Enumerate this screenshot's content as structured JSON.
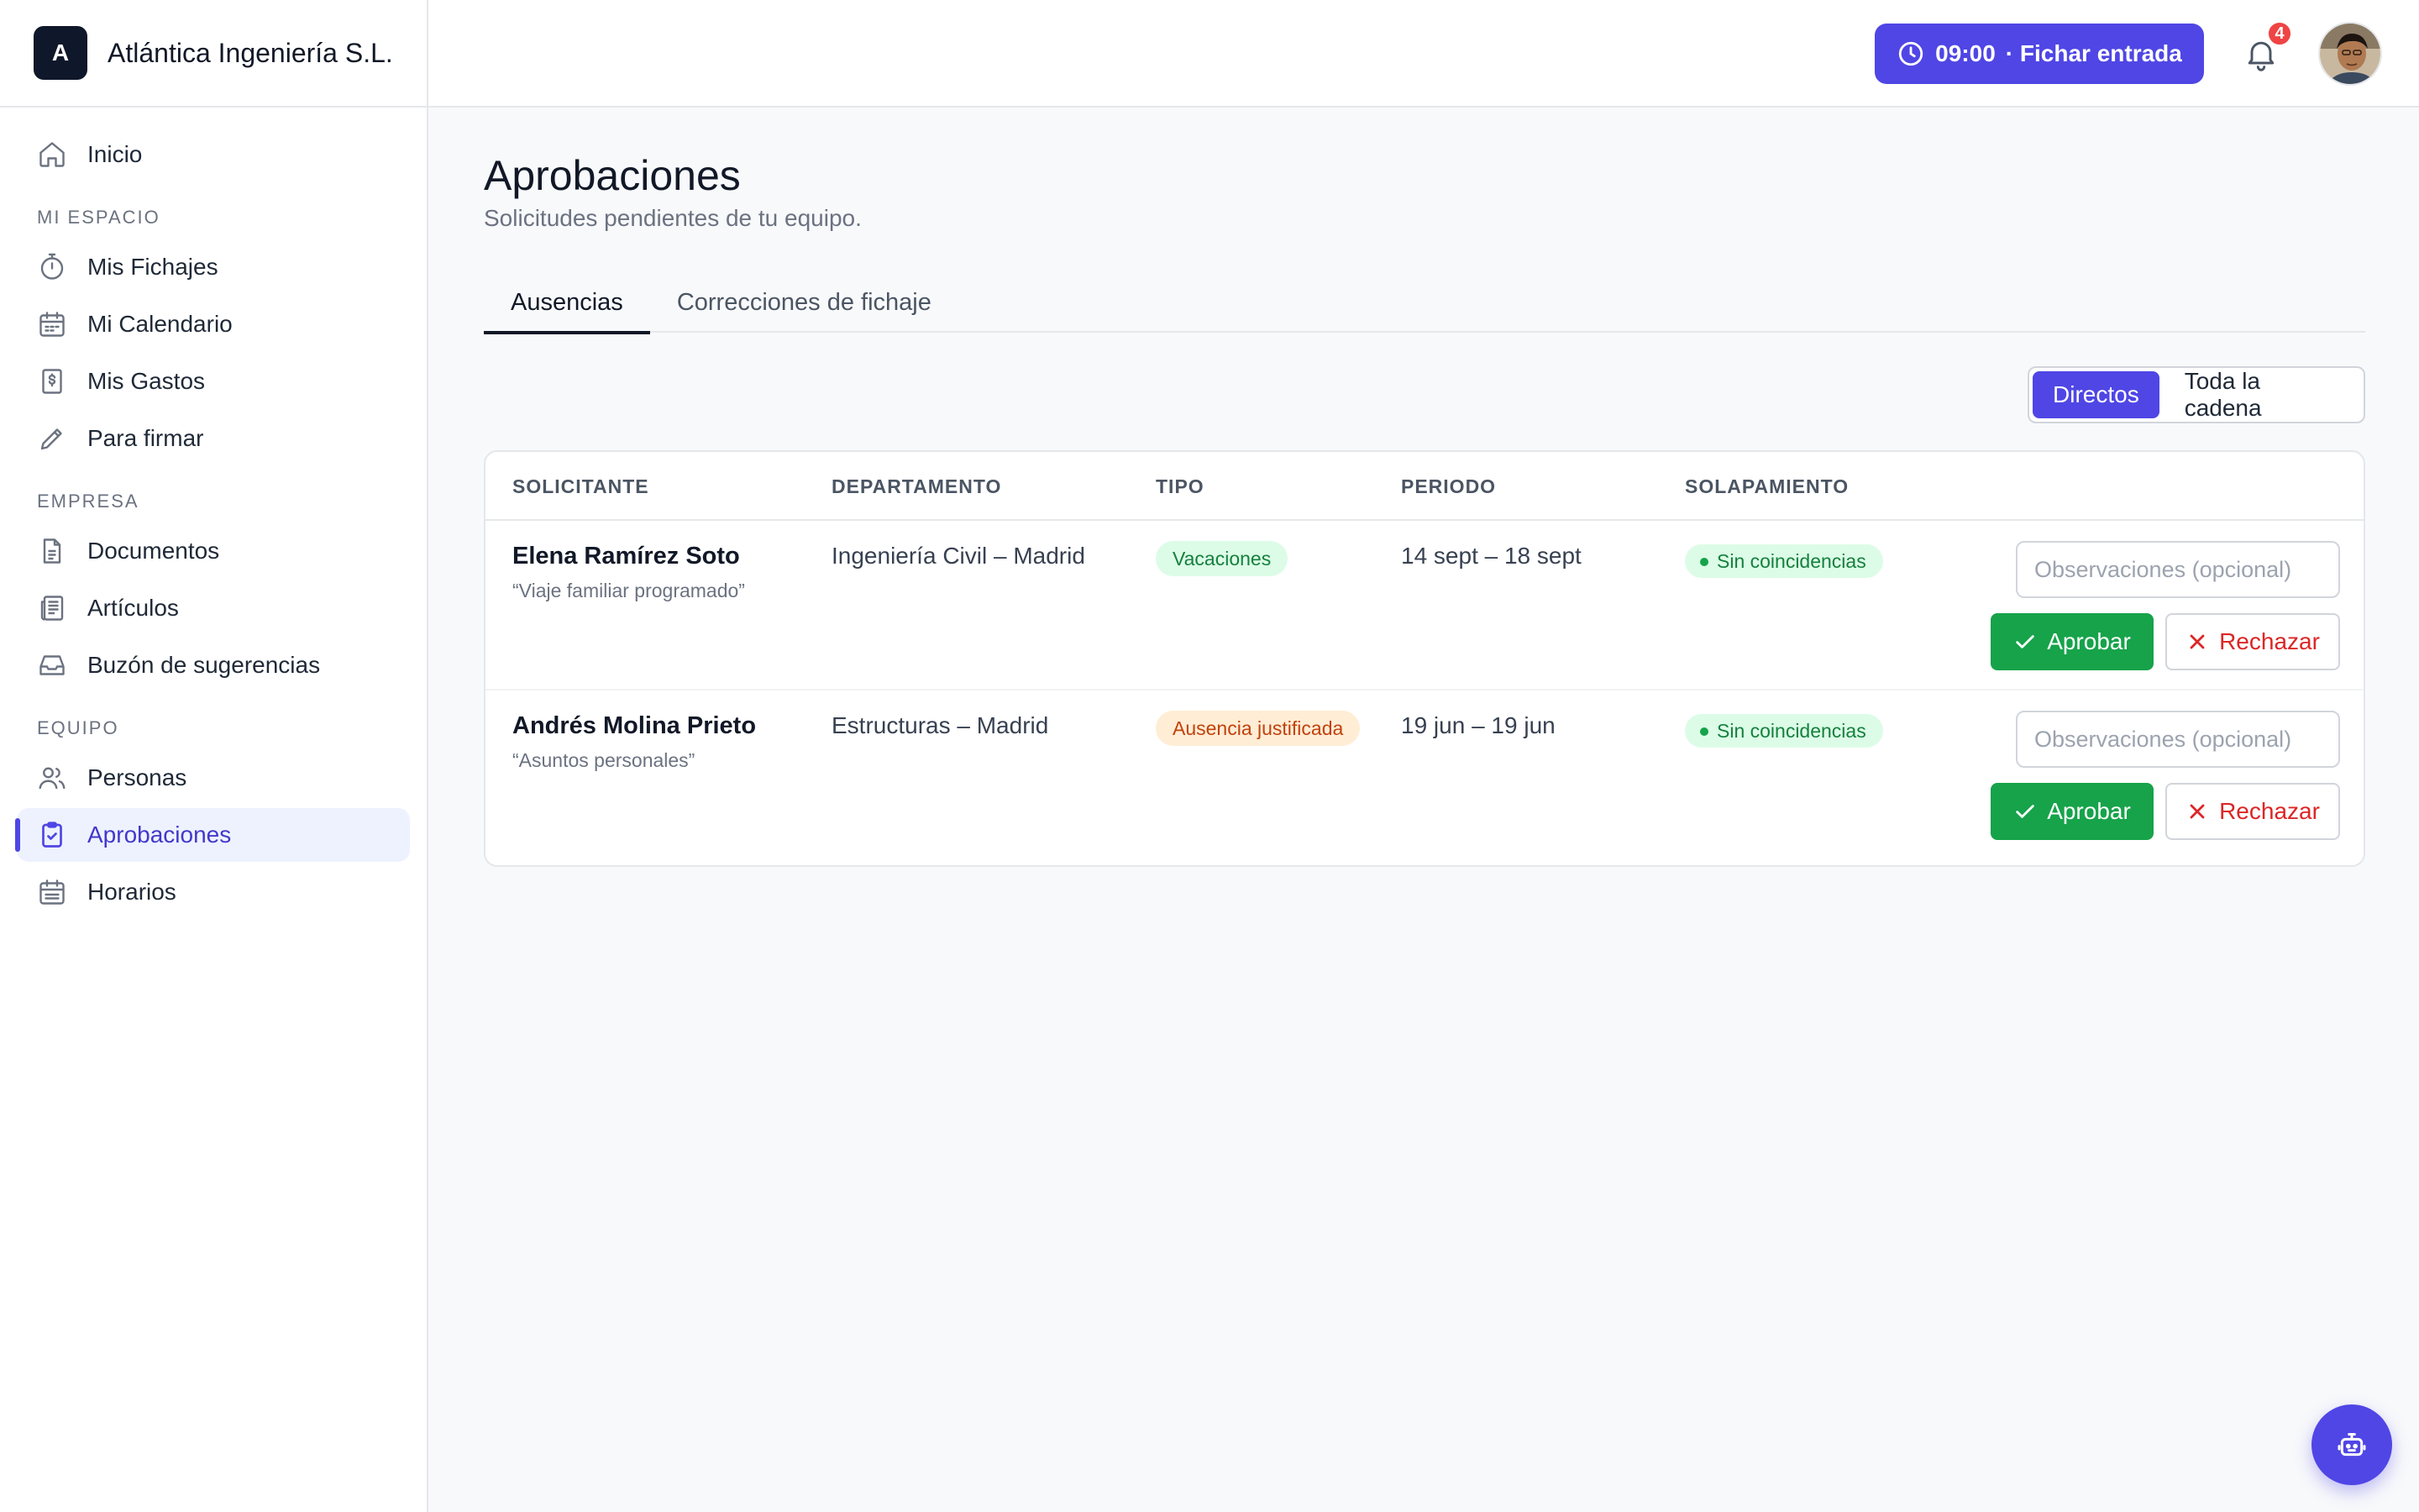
{
  "brand": {
    "logo_letter": "A",
    "name": "Atlántica Ingeniería S.L."
  },
  "sidebar": {
    "home": {
      "label": "Inicio",
      "icon": "home-icon"
    },
    "sections": [
      {
        "title": "MI ESPACIO",
        "items": [
          {
            "label": "Mis Fichajes",
            "icon": "stopwatch-icon"
          },
          {
            "label": "Mi Calendario",
            "icon": "calendar-icon"
          },
          {
            "label": "Mis Gastos",
            "icon": "receipt-icon"
          },
          {
            "label": "Para firmar",
            "icon": "pen-icon"
          }
        ]
      },
      {
        "title": "EMPRESA",
        "items": [
          {
            "label": "Documentos",
            "icon": "document-icon"
          },
          {
            "label": "Artículos",
            "icon": "newspaper-icon"
          },
          {
            "label": "Buzón de sugerencias",
            "icon": "inbox-icon"
          }
        ]
      },
      {
        "title": "EQUIPO",
        "items": [
          {
            "label": "Personas",
            "icon": "users-icon"
          },
          {
            "label": "Aprobaciones",
            "icon": "clipboard-check-icon",
            "active": true
          },
          {
            "label": "Horarios",
            "icon": "calendar-grid-icon"
          }
        ]
      }
    ]
  },
  "topbar": {
    "clock_time": "09:00",
    "clock_action": "· Fichar entrada",
    "notifications_count": "4"
  },
  "page": {
    "title": "Aprobaciones",
    "subtitle": "Solicitudes pendientes de tu equipo.",
    "tabs": [
      "Ausencias",
      "Correcciones de fichaje"
    ],
    "active_tab": 0,
    "scope_toggle": [
      "Directos",
      "Toda la cadena"
    ],
    "active_scope": 0
  },
  "table": {
    "headers": {
      "requester": "SOLICITANTE",
      "department": "DEPARTAMENTO",
      "type": "TIPO",
      "period": "PERIODO",
      "overlap": "SOLAPAMIENTO"
    },
    "rows": [
      {
        "name": "Elena Ramírez Soto",
        "note": "“Viaje familiar programado”",
        "department": "Ingeniería Civil – Madrid",
        "type": "Vacaciones",
        "type_color": "green",
        "period": "14 sept – 18 sept",
        "overlap": "Sin coincidencias",
        "observations_placeholder": "Observaciones (opcional)",
        "approve_label": "Aprobar",
        "reject_label": "Rechazar"
      },
      {
        "name": "Andrés Molina Prieto",
        "note": "“Asuntos personales”",
        "department": "Estructuras – Madrid",
        "type": "Ausencia justificada",
        "type_color": "orange",
        "period": "19 jun – 19 jun",
        "overlap": "Sin coincidencias",
        "observations_placeholder": "Observaciones (opcional)",
        "approve_label": "Aprobar",
        "reject_label": "Rechazar"
      }
    ]
  },
  "colors": {
    "accent": "#4f46e5",
    "approve": "#16a34a",
    "reject": "#dc2626",
    "badge": "#ef4444"
  }
}
